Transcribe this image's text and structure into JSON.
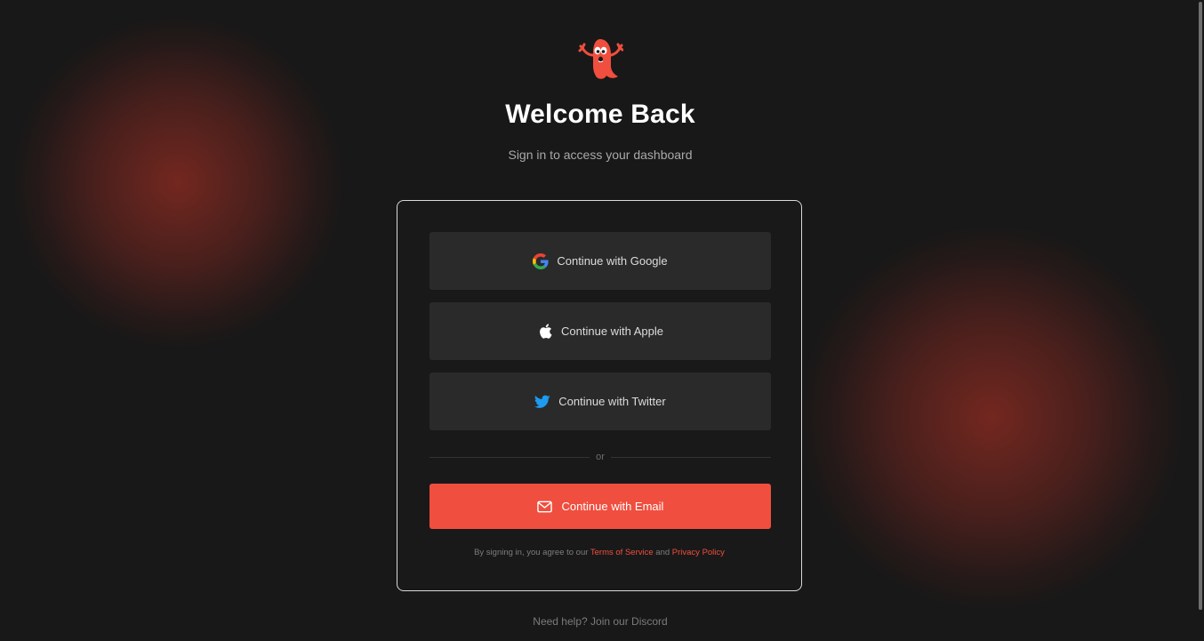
{
  "header": {
    "title": "Welcome Back",
    "subtitle": "Sign in to access your dashboard"
  },
  "auth": {
    "google_label": "Continue with Google",
    "apple_label": "Continue with Apple",
    "twitter_label": "Continue with Twitter",
    "divider_text": "or",
    "email_label": "Continue with Email"
  },
  "legal": {
    "prefix": "By signing in, you agree to our",
    "terms_link": "Terms of Service",
    "conjunction": "and",
    "privacy_link": "Privacy Policy"
  },
  "footer": {
    "help_prefix": "Need help?",
    "discord_link": "Join our Discord"
  },
  "icons": {
    "logo": "ghost-mascot-logo",
    "google": "google-icon",
    "apple": "apple-icon",
    "twitter": "twitter-bird-icon",
    "email": "envelope-icon"
  },
  "colors": {
    "accent": "#f04e3e",
    "background": "#181818",
    "card_border": "#d9d9d9",
    "button_bg": "#2a2a2a",
    "twitter_blue": "#1d9bf0"
  }
}
